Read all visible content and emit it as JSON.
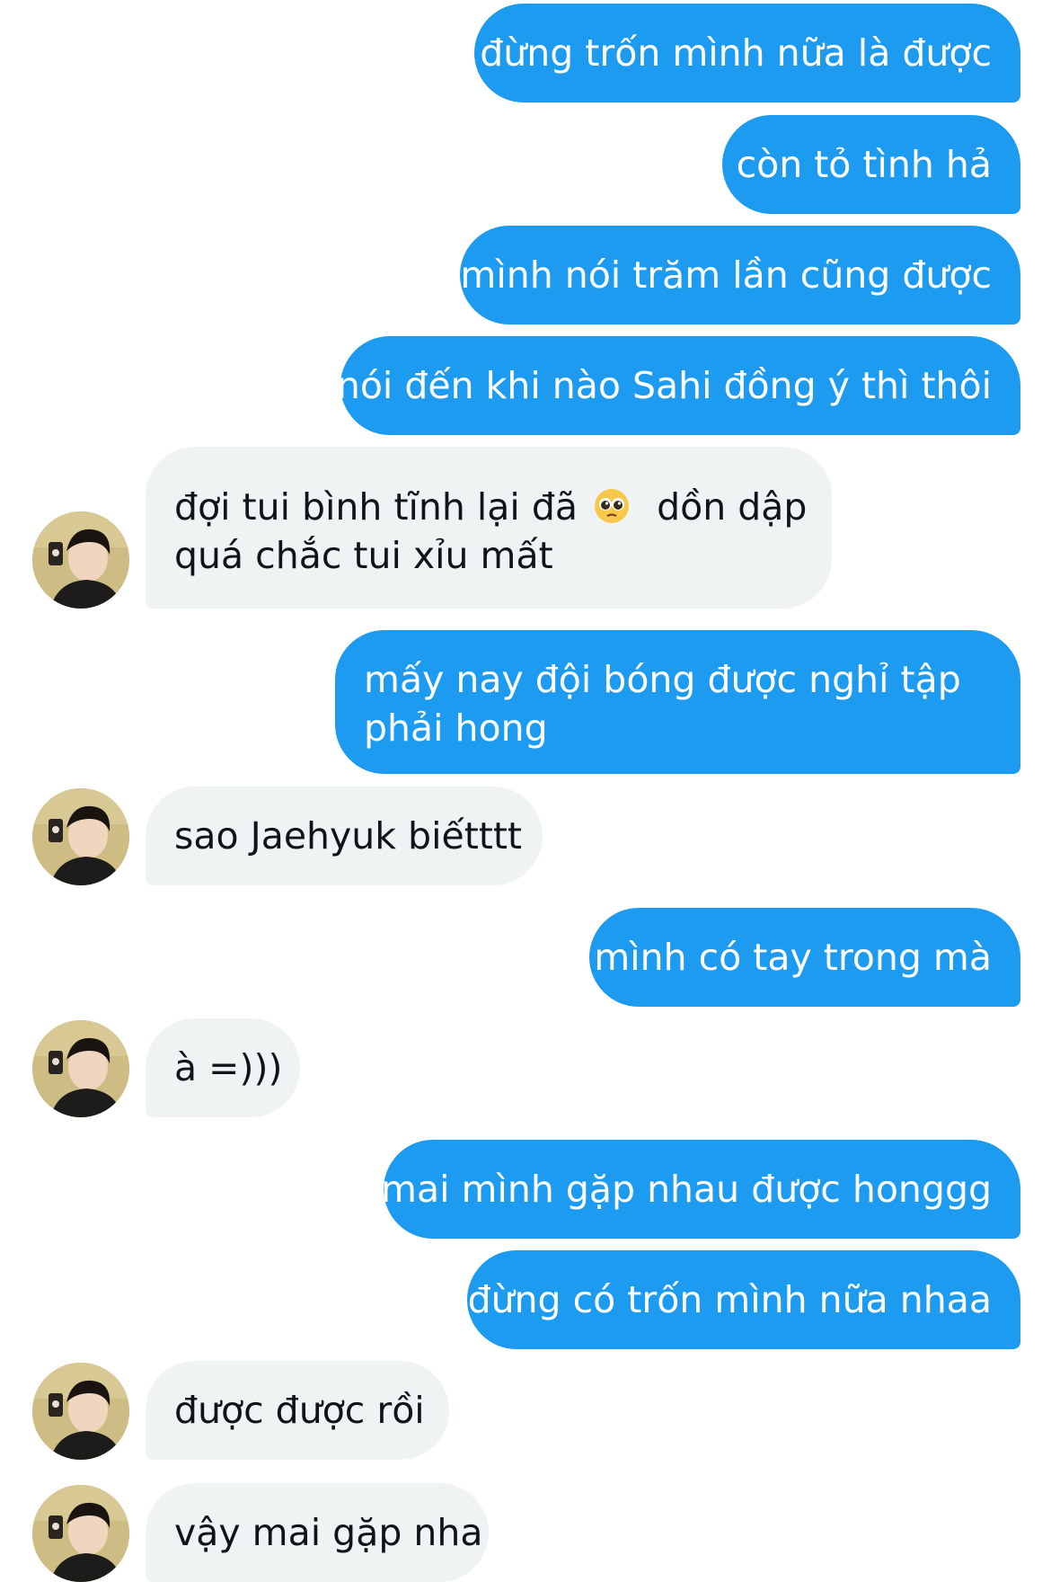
{
  "conversation": {
    "messages": [
      {
        "side": "out",
        "text": "đừng trốn mình nữa là được"
      },
      {
        "side": "out",
        "text": "còn tỏ tình hả"
      },
      {
        "side": "out",
        "text": "mình nói trăm lần cũng được"
      },
      {
        "side": "out",
        "text": "nói đến khi nào Sahi đồng ý thì thôi"
      },
      {
        "side": "in",
        "line1a": "đợi tui bình tĩnh lại đã",
        "emoji": "pleading-face-icon",
        "line1b": "dồn dập",
        "line2": "quá chắc tui xỉu mất"
      },
      {
        "side": "out",
        "line1": "mấy nay đội bóng được nghỉ tập",
        "line2": "phải hong"
      },
      {
        "side": "in",
        "text": "sao Jaehyuk biếtttt"
      },
      {
        "side": "out",
        "text": "mình có tay trong mà"
      },
      {
        "side": "in",
        "text": "à =)))"
      },
      {
        "side": "out",
        "text": "mai mình gặp nhau được honggg"
      },
      {
        "side": "out",
        "text": "đừng có trốn mình nữa nhaa"
      },
      {
        "side": "in",
        "text": "được được rồi"
      },
      {
        "side": "in",
        "text": "vậy mai gặp nha"
      }
    ]
  },
  "colors": {
    "outgoing_bubble": "#1d9bf0",
    "incoming_bubble": "#eff3f4",
    "incoming_text": "#0f1419",
    "background": "#ffffff"
  }
}
